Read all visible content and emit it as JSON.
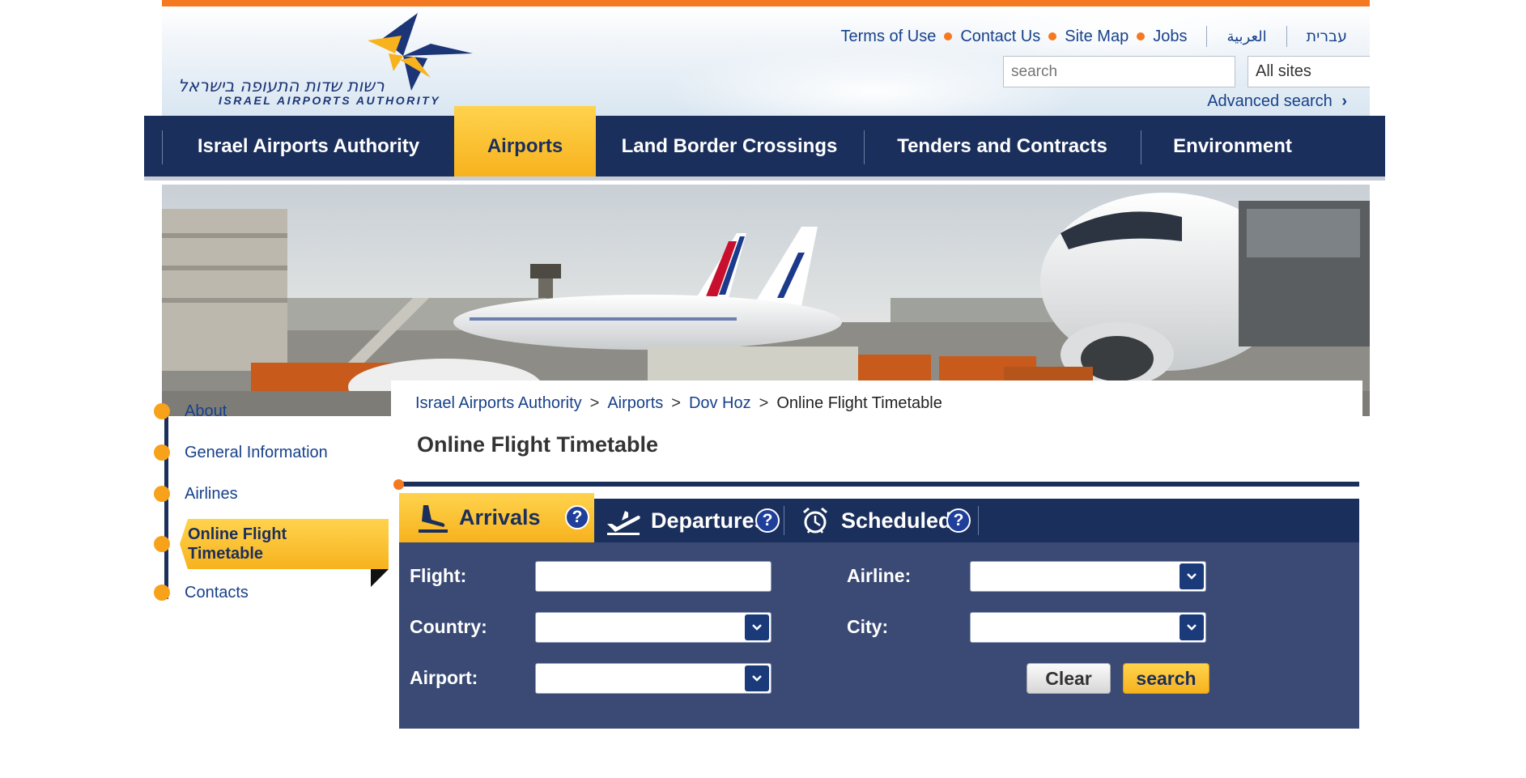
{
  "header": {
    "logo_hebrew": "רשות שדות התעופה בישראל",
    "logo_english": "ISRAEL AIRPORTS AUTHORITY",
    "top_links": [
      "Terms of Use",
      "Contact Us",
      "Site Map",
      "Jobs"
    ],
    "lang_arabic": "العربية",
    "lang_hebrew": "עברית",
    "search_placeholder": "search",
    "site_select_value": "All sites",
    "advanced_search": "Advanced search"
  },
  "nav": {
    "items": [
      "Israel Airports Authority",
      "Airports",
      "Land Border Crossings",
      "Tenders and Contracts",
      "Environment"
    ],
    "active": "Airports"
  },
  "sidebar": {
    "items": [
      "About",
      "General Information",
      "Airlines",
      "Online Flight Timetable",
      "Contacts"
    ],
    "active_line1": "Online Flight",
    "active_line2": "Timetable"
  },
  "breadcrumb": {
    "items": [
      "Israel Airports Authority",
      "Airports",
      "Dov Hoz"
    ],
    "separator": ">",
    "current": "Online Flight Timetable"
  },
  "page_title": "Online Flight Timetable",
  "tabs": {
    "items": [
      "Arrivals",
      "Departures",
      "Scheduled"
    ],
    "active": "Arrivals",
    "help": "?"
  },
  "form": {
    "flight_label": "Flight:",
    "airline_label": "Airline:",
    "country_label": "Country:",
    "city_label": "City:",
    "airport_label": "Airport:",
    "clear_label": "Clear",
    "search_label": "search"
  },
  "colors": {
    "navy": "#1b2f5c",
    "orange": "#f47920",
    "gold": "#f7b21e",
    "form_bg": "#3a4a74"
  }
}
